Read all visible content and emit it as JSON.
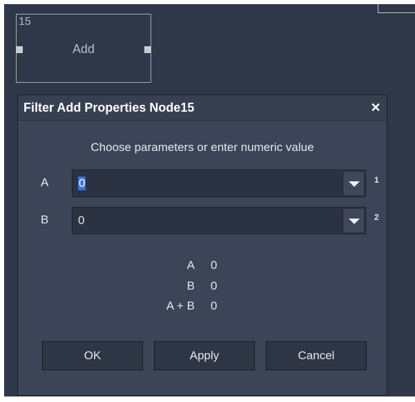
{
  "node": {
    "id": "15",
    "title": "Add"
  },
  "dialog": {
    "title": "Filter Add Properties Node15",
    "close_label": "✕",
    "instruction": "Choose parameters or enter numeric value",
    "params": [
      {
        "label": "A",
        "value": "0",
        "index": "1"
      },
      {
        "label": "B",
        "value": "0",
        "index": "2"
      }
    ],
    "summary": [
      {
        "label": "A",
        "value": "0"
      },
      {
        "label": "B",
        "value": "0"
      },
      {
        "label": "A + B",
        "value": "0"
      }
    ],
    "buttons": {
      "ok": "OK",
      "apply": "Apply",
      "cancel": "Cancel"
    }
  },
  "colors": {
    "background": "#2f3848",
    "dialog": "#3b4557",
    "selection": "#3b6fd8"
  }
}
